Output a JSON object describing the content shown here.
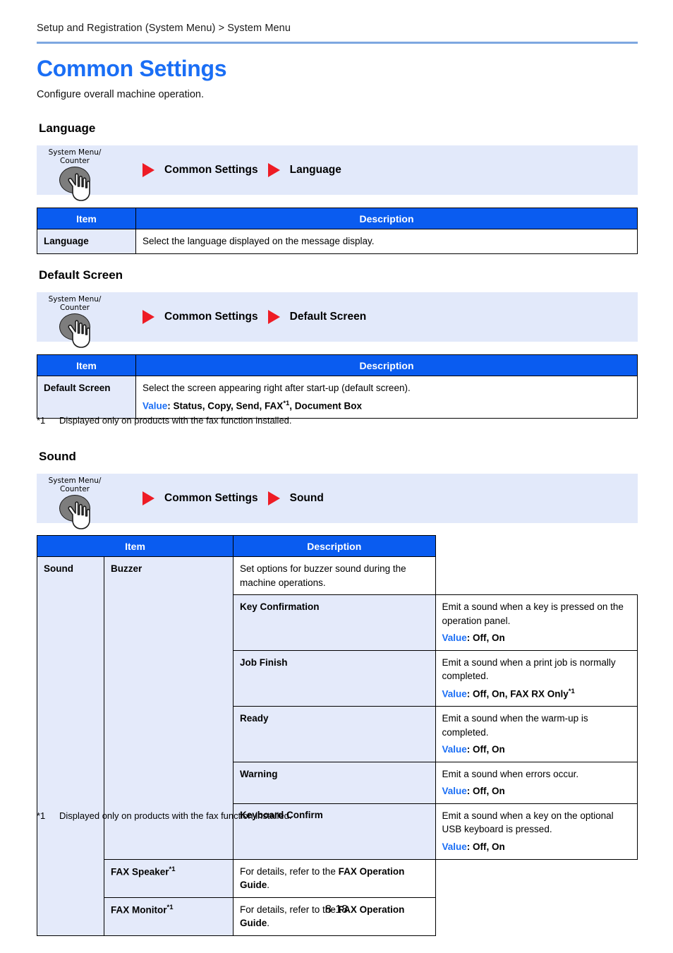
{
  "header": {
    "breadcrumb": "Setup and Registration (System Menu) > System Menu"
  },
  "title": "Common Settings",
  "subtitle": "Configure overall machine operation.",
  "colors": {
    "title_blue": "#1a6ef5",
    "table_header_blue": "#0a5cf0",
    "item_cell_blue": "#e4eafa",
    "navbox_blue": "#e2e9fa",
    "arrow_red": "#ee1c25",
    "rule_blue": "#7da7e0"
  },
  "sections": [
    {
      "heading": "Language",
      "nav": {
        "key_label_line1": "System Menu/",
        "key_label_line2": "Counter",
        "path": [
          "Common Settings",
          "Language"
        ]
      },
      "table": {
        "headers": [
          "Item",
          "Description"
        ],
        "rows": [
          {
            "item": "Language",
            "desc": "Select the language displayed on the message display."
          }
        ]
      },
      "footnotes": []
    },
    {
      "heading": "Default Screen",
      "nav": {
        "key_label_line1": "System Menu/",
        "key_label_line2": "Counter",
        "path": [
          "Common Settings",
          "Default Screen"
        ]
      },
      "table": {
        "headers": [
          "Item",
          "Description"
        ],
        "rows": [
          {
            "item": "Default Screen",
            "desc": "Select the screen appearing right after start-up (default screen).",
            "value_label": "Value",
            "value_text_a": ": Status, Copy, Send, FAX",
            "value_fn": "*1",
            "value_text_b": ", Document Box"
          }
        ]
      },
      "footnotes": [
        {
          "mark": "*1",
          "text": "Displayed only on products with the fax function installed."
        }
      ]
    },
    {
      "heading": "Sound",
      "nav": {
        "key_label_line1": "System Menu/",
        "key_label_line2": "Counter",
        "path": [
          "Common Settings",
          "Sound"
        ]
      },
      "table": {
        "headers": [
          "Item",
          "Description"
        ],
        "rows": [
          {
            "col1": "Sound",
            "col2": "Buzzer",
            "desc": "Set options for buzzer sound during the machine operations."
          },
          {
            "col3": "Key Confirmation",
            "desc": "Emit a sound when a key is pressed on the operation panel.",
            "value_label": "Value",
            "value_text": ": Off, On"
          },
          {
            "col3": "Job Finish",
            "desc": "Emit a sound when a print job is normally completed.",
            "value_label": "Value",
            "value_text": ": Off, On, FAX RX Only",
            "value_fn": "*1"
          },
          {
            "col3": "Ready",
            "desc": "Emit a sound when the warm-up is completed.",
            "value_label": "Value",
            "value_text": ": Off, On"
          },
          {
            "col3": "Warning",
            "desc": "Emit a sound when errors occur.",
            "value_label": "Value",
            "value_text": ": Off, On"
          },
          {
            "col3": "Keyboard Confirm",
            "desc": "Emit a sound when a key on the optional USB keyboard is pressed.",
            "value_label": "Value",
            "value_text": ": Off, On"
          },
          {
            "col2span": "FAX Speaker",
            "col2span_fn": "*1",
            "desc_a": "For details, refer to the ",
            "desc_bold": "FAX Operation Guide",
            "desc_b": "."
          },
          {
            "col2span": "FAX Monitor",
            "col2span_fn": "*1",
            "desc_a": "For details, refer to the ",
            "desc_bold": "FAX Operation Guide",
            "desc_b": "."
          }
        ]
      },
      "footnotes": [
        {
          "mark": "*1",
          "text": "Displayed only on products with the fax function installed."
        }
      ]
    }
  ],
  "page_number": "8-18"
}
